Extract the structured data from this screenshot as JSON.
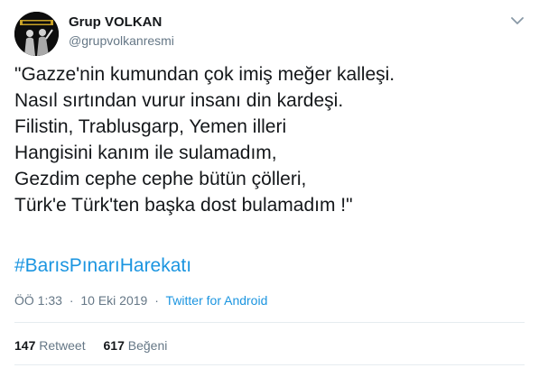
{
  "user": {
    "name": "Grup VOLKAN",
    "handle": "@grupvolkanresmi",
    "avatar_icon": "band-avatar"
  },
  "tweet": {
    "lines": [
      "\"Gazze'nin kumundan çok imiş meğer kalleşi.",
      "Nasıl sırtından vurur insanı din kardeşi.",
      "Filistin, Trablusgarp, Yemen illeri",
      "Hangisini kanım ile sulamadım,",
      "Gezdim cephe cephe bütün çölleri,",
      "Türk'e Türk'ten başka dost bulamadım !\""
    ],
    "hashtag": "#BarısPınarıHarekatı"
  },
  "meta": {
    "time": "ÖÖ 1:33",
    "separator1": "·",
    "date": "10 Eki 2019",
    "separator2": "·",
    "source": "Twitter for Android"
  },
  "stats": {
    "retweet_count": "147",
    "retweet_label": "Retweet",
    "like_count": "617",
    "like_label": "Beğeni"
  },
  "colors": {
    "link": "#1b95e0",
    "secondary_text": "#657786",
    "primary_text": "#14171a",
    "divider": "#e6ecf0"
  }
}
